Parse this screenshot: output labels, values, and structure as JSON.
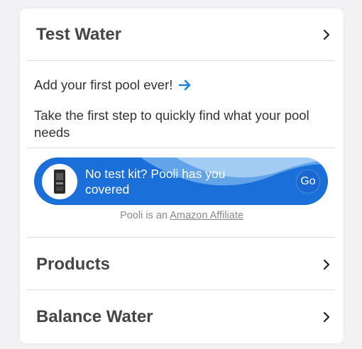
{
  "sections": {
    "test_water": {
      "title": "Test Water",
      "icon": "chevron-right-icon"
    },
    "products": {
      "title": "Products",
      "icon": "chevron-right-icon"
    },
    "balance_water": {
      "title": "Balance Water",
      "icon": "chevron-right-icon"
    }
  },
  "onboarding": {
    "prompt": "Add your first pool ever!",
    "prompt_icon": "arrow-right-icon",
    "description": "Take the first step to quickly find what your pool needs"
  },
  "banner": {
    "text": "No test kit? Pooli has you covered",
    "go_label": "Go",
    "image_icon": "test-kit-icon"
  },
  "affiliate": {
    "prefix": "Pooli is an",
    "link_text": "Amazon Affiliate"
  },
  "colors": {
    "accent": "#1b6fd8",
    "arrow": "#1e88e5",
    "text_dark": "#454545",
    "text_muted": "#8a8a8a"
  }
}
